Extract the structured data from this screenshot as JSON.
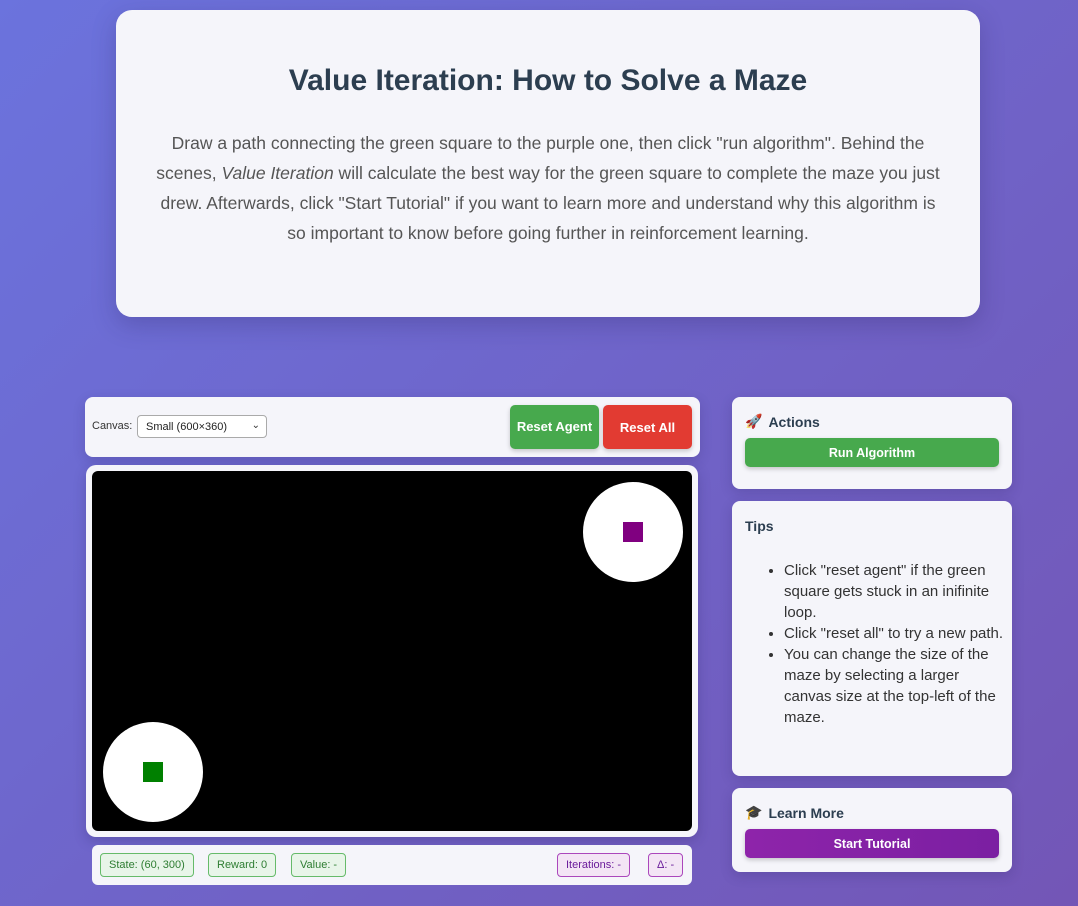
{
  "hero": {
    "title": "Value Iteration: How to Solve a Maze",
    "desc_part1": "Draw a path connecting the green square to the purple one, then click \"run algorithm\". Behind the scenes, ",
    "desc_em": "Value Iteration",
    "desc_part2": " will calculate the best way for the green square to complete the maze you just drew. Afterwards, click \"Start Tutorial\" if you want to learn more and understand why this algorithm is so important to know before going further in reinforcement learning."
  },
  "toolbar": {
    "canvas_label": "Canvas:",
    "canvas_selected": "Small (600×360)",
    "reset_agent_label": "Reset Agent",
    "reset_all_label": "Reset All"
  },
  "maze": {
    "background": "#000000",
    "agent_color": "#008000",
    "goal_color": "#800080"
  },
  "status": {
    "state": "State: (60, 300)",
    "reward": "Reward: 0",
    "value": "Value: -",
    "iterations": "Iterations: -",
    "delta": "Δ: -"
  },
  "actions": {
    "icon": "rocket-icon",
    "title": "Actions",
    "run_label": "Run Algorithm",
    "run_color": "#47a94d"
  },
  "tips": {
    "title": "Tips",
    "items": [
      "Click \"reset agent\" if the green square gets stuck in an inifinite loop.",
      "Click \"reset all\" to try a new path.",
      "You can change the size of the maze by selecting a larger canvas size at the top-left of the maze."
    ]
  },
  "learn": {
    "icon": "graduation-cap-icon",
    "title": "Learn More",
    "tutorial_label": "Start Tutorial",
    "tutorial_color": "#8e24aa"
  }
}
